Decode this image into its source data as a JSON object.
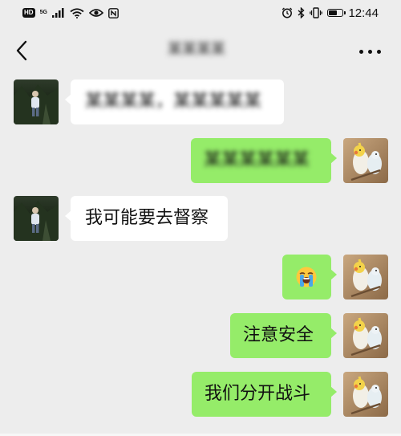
{
  "status_bar": {
    "hd_label": "HD",
    "network_label": "5G",
    "time": "12:44"
  },
  "header": {
    "chat_title": "某某某某",
    "back_icon": "chevron-left-icon",
    "more_icon": "more-dots-icon"
  },
  "messages": [
    {
      "side": "left",
      "sender": "contact",
      "text": "某某某某，某某某某某",
      "blurred": true
    },
    {
      "side": "right",
      "sender": "me",
      "text": "某某某某某某",
      "blurred": true
    },
    {
      "side": "left",
      "sender": "contact",
      "text": "我可能要去督察",
      "blurred": false
    },
    {
      "side": "right",
      "sender": "me",
      "text": "",
      "emoji": "loudly-crying-face-icon"
    },
    {
      "side": "right",
      "sender": "me",
      "text": "注意安全",
      "blurred": false
    },
    {
      "side": "right",
      "sender": "me",
      "text": "我们分开战斗",
      "blurred": false
    }
  ],
  "colors": {
    "background": "#ededed",
    "bubble_self": "#95ec69",
    "bubble_other": "#ffffff"
  }
}
